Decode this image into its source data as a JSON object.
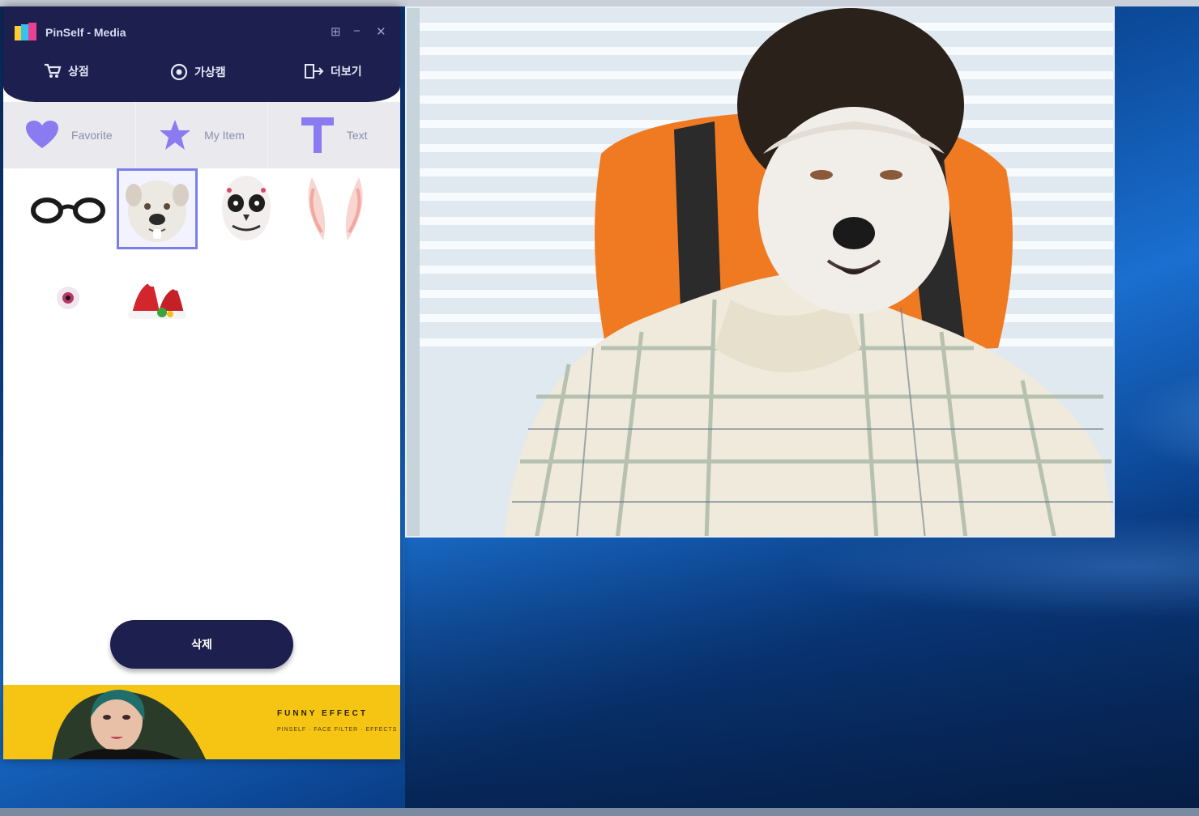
{
  "window": {
    "title": "PinSelf - Media",
    "controls": {
      "settings": "⊞",
      "minimize": "−",
      "close": "✕"
    }
  },
  "nav": [
    {
      "icon": "cart-icon",
      "label": "상점"
    },
    {
      "icon": "globe-icon",
      "label": "가상캠"
    },
    {
      "icon": "share-icon",
      "label": "더보기"
    }
  ],
  "tabs": [
    {
      "icon": "heart-icon",
      "label": "Favorite",
      "color": "#8a7cf0"
    },
    {
      "icon": "star-icon",
      "label": "My Item",
      "color": "#8a7cf0"
    },
    {
      "icon": "text-icon",
      "label": "Text",
      "color": "#8a7cf0"
    }
  ],
  "items": [
    {
      "name": "glasses-sticker",
      "selected": false
    },
    {
      "name": "dog-face-sticker",
      "selected": true
    },
    {
      "name": "skull-face-sticker",
      "selected": false
    },
    {
      "name": "bunny-ears-sticker",
      "selected": false
    },
    {
      "name": "eye-sticker",
      "selected": false
    },
    {
      "name": "christmas-sticker",
      "selected": false
    }
  ],
  "apply_button": {
    "label": "삭제"
  },
  "ad": {
    "title": "FUNNY EFFECT",
    "subtitle": "PINSELF · FACE FILTER · EFFECTS"
  },
  "colors": {
    "header": "#1d1f4e",
    "accent": "#8a7cf0",
    "ad_bg": "#f6c413"
  }
}
